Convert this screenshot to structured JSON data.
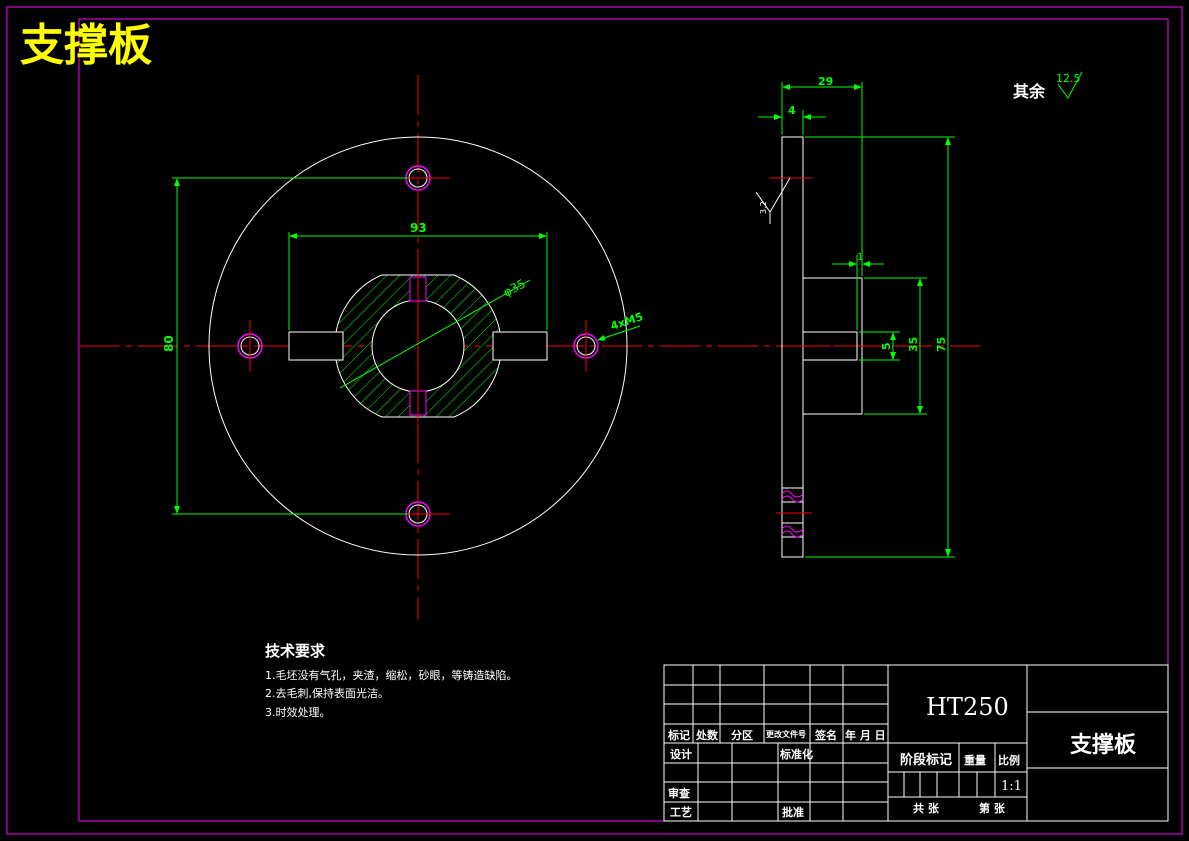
{
  "title": "支撑板",
  "surface_note": {
    "label": "其余",
    "roughness": "12.5"
  },
  "tech_requirements": {
    "heading": "技术要求",
    "items": [
      "1.毛坯没有气孔，夹渣，缩松，砂眼，等铸造缺陷。",
      "2.去毛刺,保持表面光洁。",
      "3.时效处理。"
    ]
  },
  "front_view_dims": {
    "width_93": "93",
    "height_80": "80",
    "bore_dia": "φ35",
    "holes": "4xM5"
  },
  "side_view_dims": {
    "top_29": "29",
    "top_4": "4",
    "small_1": "1",
    "h_5": "5",
    "h_35": "35",
    "h_75": "75",
    "roughness_side": "3.2"
  },
  "title_block": {
    "material": "HT250",
    "part_name": "支撑板",
    "header_labels": [
      "标记",
      "处数",
      "分区",
      "更改文件号",
      "签名",
      "年 月 日"
    ],
    "design": "设计",
    "standardize": "标准化",
    "review": "审查",
    "process": "工艺",
    "approve": "批准",
    "stage_mark": "阶段标记",
    "weight": "重量",
    "scale_label": "比例",
    "scale_value": "1:1",
    "total_sheets": "共 张",
    "sheet_no": "第 张"
  },
  "colors": {
    "frame": "#ff00ff",
    "line": "#ffffff",
    "center": "#ff0000",
    "dim": "#00ff00",
    "hatch": "#00ff00",
    "thread": "#ff00ff",
    "title": "#ffff00"
  }
}
